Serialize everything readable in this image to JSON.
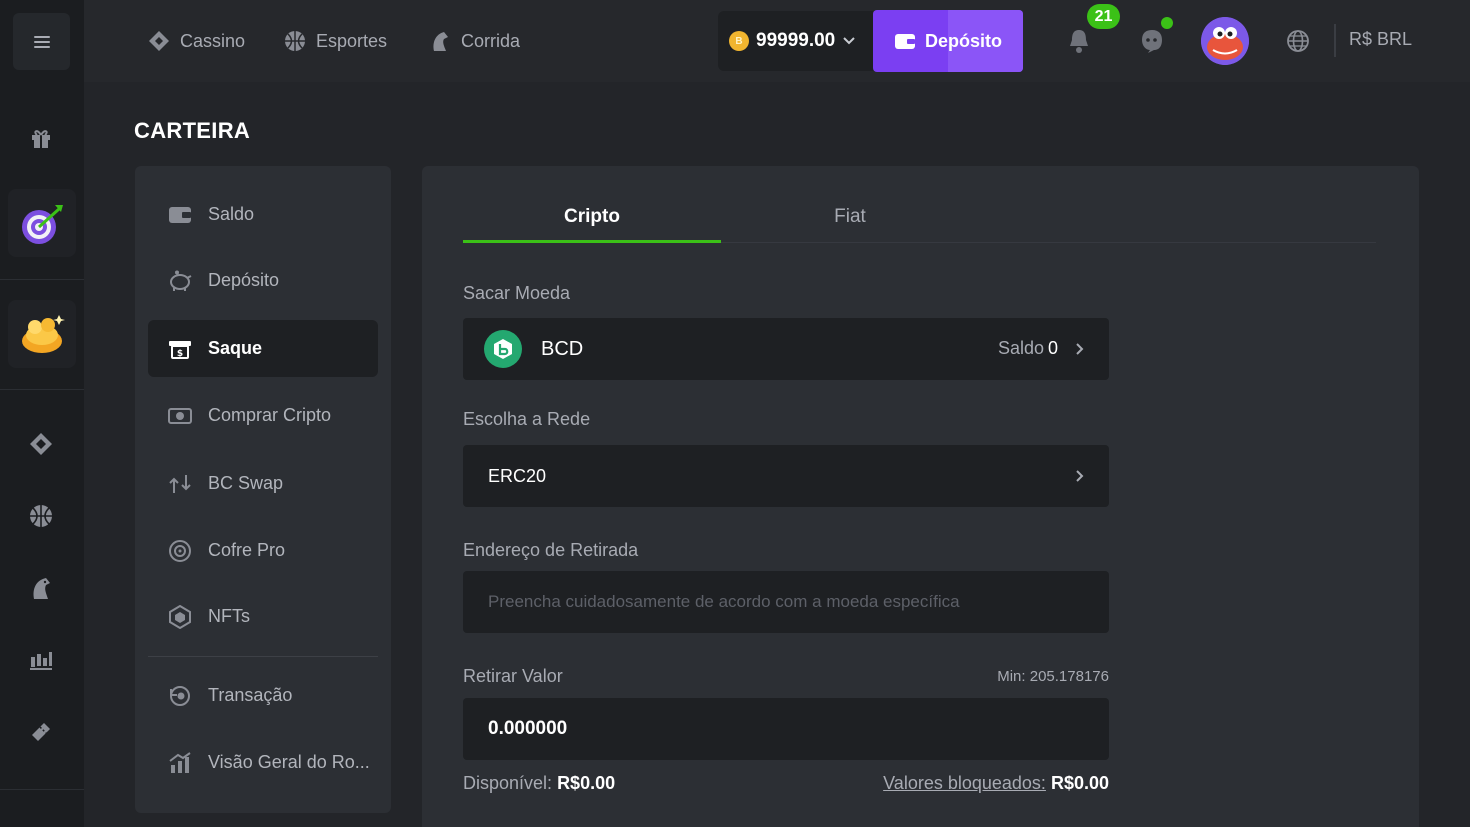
{
  "nav": {
    "items": [
      {
        "label": "Cassino",
        "icon": "casino-icon"
      },
      {
        "label": "Esportes",
        "icon": "sports-ball-icon"
      },
      {
        "label": "Corrida",
        "icon": "horse-racing-icon"
      }
    ]
  },
  "header": {
    "balance": "99999.00",
    "coin_symbol": "B",
    "deposit_label": "Depósito",
    "notification_count": "21",
    "currency": "R$ BRL"
  },
  "page": {
    "title": "CARTEIRA"
  },
  "sidemenu": {
    "items": [
      {
        "label": "Saldo",
        "icon": "wallet-icon"
      },
      {
        "label": "Depósito",
        "icon": "piggy-bank-icon"
      },
      {
        "label": "Saque",
        "icon": "withdraw-icon"
      },
      {
        "label": "Comprar Cripto",
        "icon": "buy-crypto-icon"
      },
      {
        "label": "BC Swap",
        "icon": "swap-icon"
      },
      {
        "label": "Cofre Pro",
        "icon": "vault-icon"
      },
      {
        "label": "NFTs",
        "icon": "nft-icon"
      },
      {
        "label": "Transação",
        "icon": "transaction-icon"
      },
      {
        "label": "Visão Geral do Ro...",
        "icon": "rollover-chart-icon"
      }
    ],
    "active": "Saque"
  },
  "withdraw": {
    "tabs": [
      "Cripto",
      "Fiat"
    ],
    "active_tab": "Cripto",
    "coin_label": "Sacar Moeda",
    "coin_name": "BCD",
    "coin_balance_label": "Saldo",
    "coin_balance_value": "0",
    "network_label": "Escolha a Rede",
    "network_value": "ERC20",
    "address_label": "Endereço de Retirada",
    "address_placeholder": "Preencha cuidadosamente de acordo com a moeda específica",
    "amount_label": "Retirar Valor",
    "amount_min": "Min: 205.178176",
    "amount_value": "0.000000",
    "available_label": "Disponível:",
    "available_value": "R$0.00",
    "locked_label": "Valores bloqueados:",
    "locked_value": "R$0.00"
  },
  "colors": {
    "accent_purple": "#7b3ff2",
    "accent_green": "#3bc117",
    "background": "#232529",
    "panel": "#2c2f34"
  }
}
